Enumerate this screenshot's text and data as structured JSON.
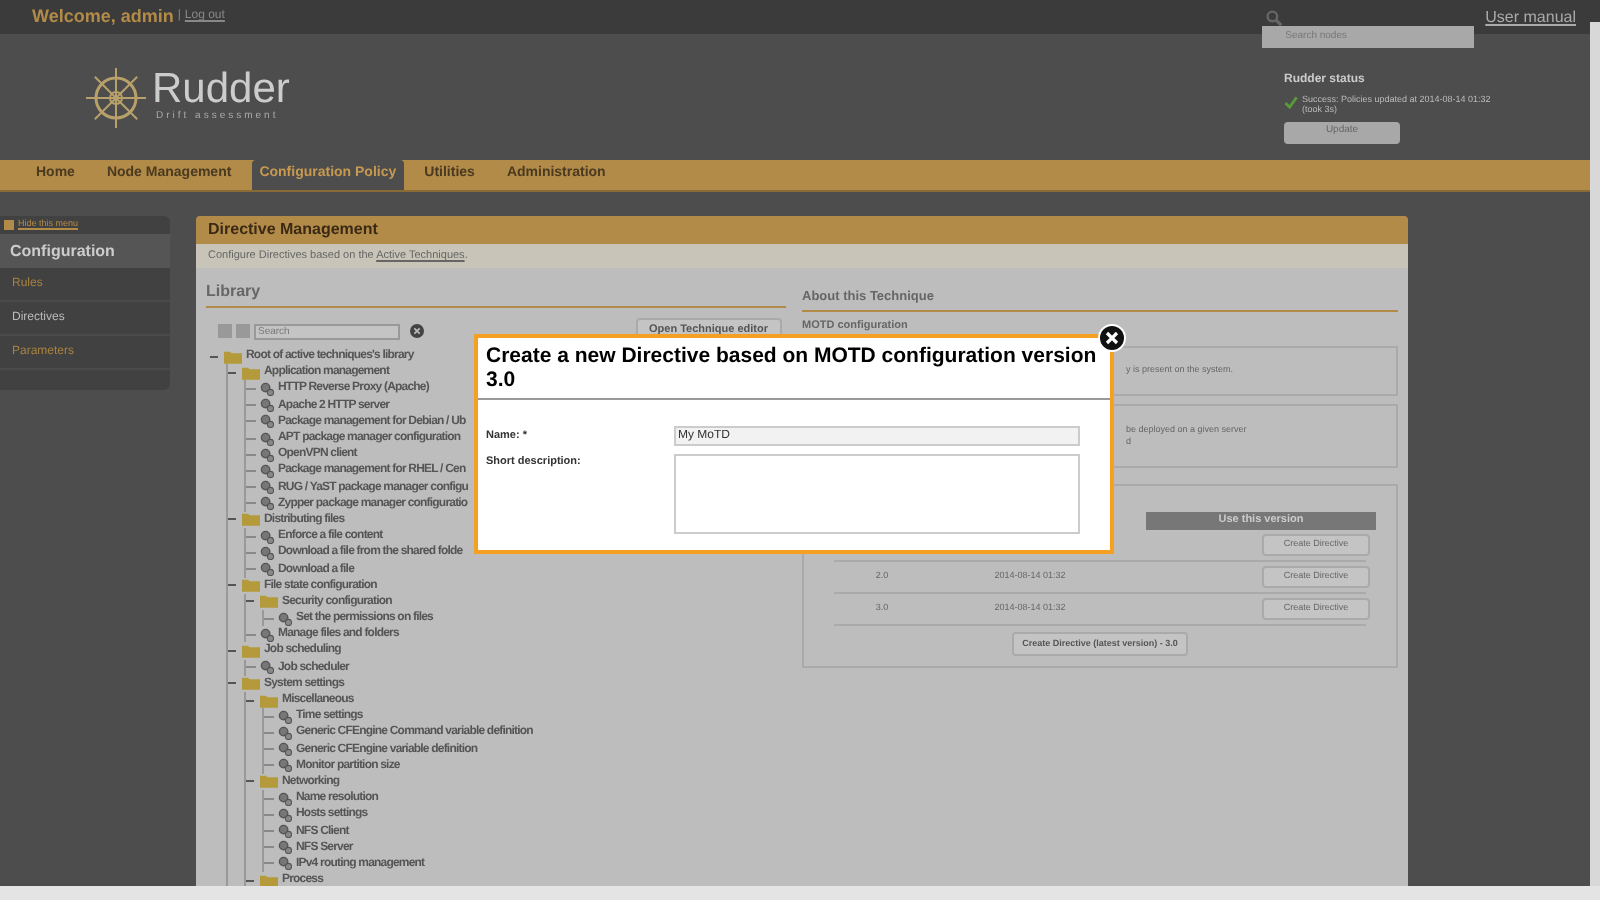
{
  "top_bar": {
    "welcome": "Welcome, admin",
    "separator": "|",
    "logout": "Log out",
    "search": {
      "placeholder": "Search nodes"
    },
    "user_manual": "User manual"
  },
  "logo": {
    "name": "Rudder",
    "tagline": "Drift assessment"
  },
  "status": {
    "title": "Rudder status",
    "message": "Success: Policies updated at 2014-08-14 01:32 (took 3s)",
    "button": "Update"
  },
  "nav": [
    {
      "label": "Home",
      "selected": false
    },
    {
      "label": "Node Management",
      "selected": false
    },
    {
      "label": "Configuration Policy",
      "selected": true
    },
    {
      "label": "Utilities",
      "selected": false
    },
    {
      "label": "Administration",
      "selected": false
    }
  ],
  "sidebar": {
    "hide": "Hide this menu",
    "title": "Configuration",
    "items": [
      {
        "label": "Rules",
        "selected": false
      },
      {
        "label": "Directives",
        "selected": true
      },
      {
        "label": "Parameters",
        "selected": false
      }
    ]
  },
  "panel": {
    "title": "Directive Management",
    "subtitle_prefix": "Configure Directives based on the ",
    "subtitle_link": "Active Techniques",
    "subtitle_suffix": "."
  },
  "library": {
    "title": "Library",
    "search": {
      "placeholder": "Search"
    },
    "editor_button": "Open Technique editor",
    "tree": [
      {
        "label": "Root of active techniques's library",
        "kind": "folder",
        "children": [
          {
            "label": "Application management",
            "kind": "folder",
            "children": [
              {
                "label": "HTTP Reverse Proxy (Apache)",
                "kind": "technique"
              },
              {
                "label": "Apache 2 HTTP server",
                "kind": "technique"
              },
              {
                "label": "Package management for Debian / Ub",
                "kind": "technique"
              },
              {
                "label": "APT package manager configuration",
                "kind": "technique"
              },
              {
                "label": "OpenVPN client",
                "kind": "technique"
              },
              {
                "label": "Package management for RHEL / Cen",
                "kind": "technique"
              },
              {
                "label": "RUG / YaST package manager configu",
                "kind": "technique"
              },
              {
                "label": "Zypper package manager configuratio",
                "kind": "technique"
              }
            ]
          },
          {
            "label": "Distributing files",
            "kind": "folder",
            "children": [
              {
                "label": "Enforce a file content",
                "kind": "technique"
              },
              {
                "label": "Download a file from the shared folde",
                "kind": "technique"
              },
              {
                "label": "Download a file",
                "kind": "technique"
              }
            ]
          },
          {
            "label": "File state configuration",
            "kind": "folder",
            "children": [
              {
                "label": "Security configuration",
                "kind": "folder",
                "children": [
                  {
                    "label": "Set the permissions on files",
                    "kind": "technique"
                  }
                ]
              },
              {
                "label": "Manage files and folders",
                "kind": "technique"
              }
            ]
          },
          {
            "label": "Job scheduling",
            "kind": "folder",
            "children": [
              {
                "label": "Job scheduler",
                "kind": "technique"
              }
            ]
          },
          {
            "label": "System settings",
            "kind": "folder",
            "children": [
              {
                "label": "Miscellaneous",
                "kind": "folder",
                "children": [
                  {
                    "label": "Time settings",
                    "kind": "technique"
                  },
                  {
                    "label": "Generic CFEngine Command variable definition",
                    "kind": "technique"
                  },
                  {
                    "label": "Generic CFEngine variable definition",
                    "kind": "technique"
                  },
                  {
                    "label": "Monitor partition size",
                    "kind": "technique"
                  }
                ]
              },
              {
                "label": "Networking",
                "kind": "folder",
                "children": [
                  {
                    "label": "Name resolution",
                    "kind": "technique"
                  },
                  {
                    "label": "Hosts settings",
                    "kind": "technique"
                  },
                  {
                    "label": "NFS Client",
                    "kind": "technique"
                  },
                  {
                    "label": "NFS Server",
                    "kind": "technique"
                  },
                  {
                    "label": "IPv4 routing management",
                    "kind": "technique"
                  }
                ]
              },
              {
                "label": "Process",
                "kind": "folder"
              }
            ]
          }
        ]
      }
    ]
  },
  "about": {
    "title": "About this Technique",
    "name": "MOTD configuration",
    "box_1": "y is present on the system.",
    "box_2_lines": [
      "be deployed on a given server",
      "d"
    ],
    "versions": {
      "header": "Use this version",
      "rows": [
        {
          "button": "Create Directive"
        },
        {
          "version": "2.0",
          "date": "2014-08-14 01:32",
          "button": "Create Directive"
        },
        {
          "version": "3.0",
          "date": "2014-08-14 01:32",
          "button": "Create Directive"
        }
      ],
      "latest_button": "Create Directive (latest version) - 3.0"
    }
  },
  "dialog": {
    "title": "Create a new Directive based on MOTD configuration version 3.0",
    "name_label": "Name: *",
    "name_value": "My MoTD",
    "description_label": "Short description:"
  }
}
